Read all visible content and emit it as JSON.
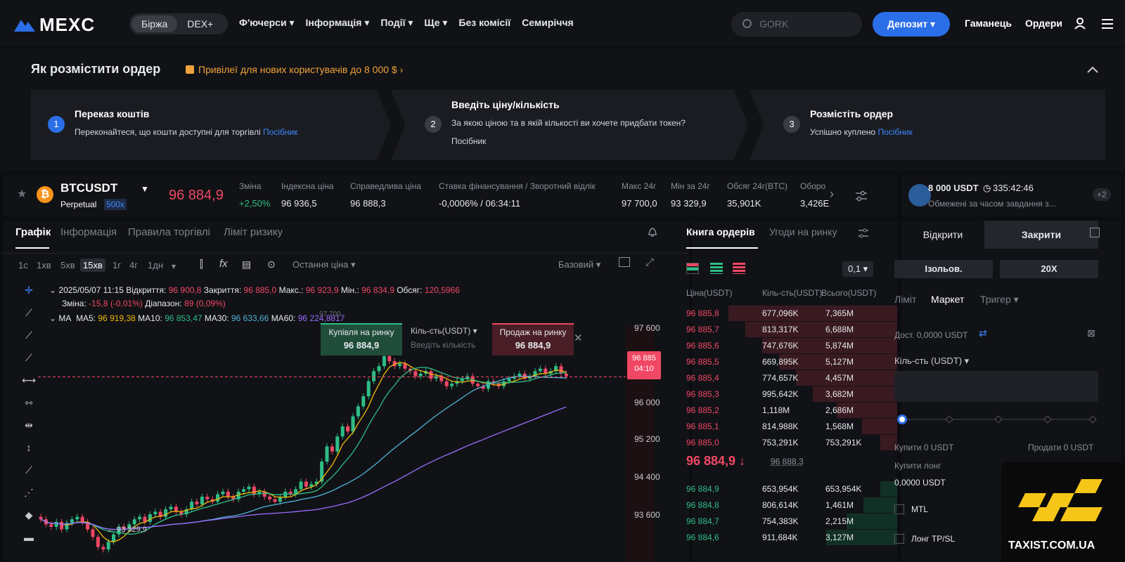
{
  "topbar": {
    "logo": "MEXC",
    "seg": [
      "Біржа",
      "DEX+"
    ],
    "nav": [
      "Ф'ючерси ▾",
      "Інформація ▾",
      "Події ▾",
      "Ще ▾",
      "Без комісії",
      "Семиріччя"
    ],
    "search_placeholder": "GORK",
    "deposit": "Депозит ▾",
    "wallet": "Гаманець",
    "orders": "Ордери"
  },
  "howto": {
    "title": "Як розмістити ордер",
    "promo": "Привілеї для нових користувачів до 8 000 $ ›",
    "steps": [
      {
        "num": "1",
        "title": "Переказ коштів",
        "desc": "Переконайтеся, що кошти доступні для торгівлі",
        "link": "Посібник"
      },
      {
        "num": "2",
        "title": "Введіть ціну/кількість",
        "desc": "За якою ціною та в якій кількості ви хочете придбати токен?",
        "link": "Посібник"
      },
      {
        "num": "3",
        "title": "Розмістіть ордер",
        "desc": "Успішно куплено",
        "link": "Посібник"
      }
    ]
  },
  "ticker": {
    "symbol": "BTCUSDT",
    "type": "Perpetual",
    "lev": "500x",
    "price": "96 884,9",
    "stats": [
      {
        "label": "Зміна",
        "value": "+2,50%"
      },
      {
        "label": "Індексна ціна",
        "value": "96 936,5"
      },
      {
        "label": "Справедлива ціна",
        "value": "96 888,3"
      },
      {
        "label": "Ставка фінансування / Зворотний відлік",
        "value": "-0,0006% / 06:34:11"
      },
      {
        "label": "Макс 24г",
        "value": "97 700,0"
      },
      {
        "label": "Мін за 24г",
        "value": "93 329,9"
      },
      {
        "label": "Обсяг 24г(BTC)",
        "value": "35,901K"
      },
      {
        "label": "Оборо",
        "value": "3,426E"
      }
    ]
  },
  "promo2": {
    "amount": "8 000 USDT",
    "timer": "335:42:46",
    "desc": "Обмежені за часом завдання з...",
    "badge": "+2"
  },
  "chart": {
    "tabs": [
      "Графік",
      "Інформація",
      "Правила торгівлі",
      "Ліміт ризику"
    ],
    "intervals": [
      "1с",
      "1хв",
      "5хв",
      "15хв",
      "1г",
      "4г",
      "1дн"
    ],
    "last_price_label": "Остання ціна ▾",
    "base_label": "Базовий ▾",
    "ohlc": {
      "date": "2025/05/07 11:15",
      "open_l": "Відкриття:",
      "open": "96 900,8",
      "close_l": "Закриття:",
      "close": "96 885,0",
      "high_l": "Макс.:",
      "high": "96 923,9",
      "low_l": "Мін.:",
      "low": "96 834,9",
      "vol_l": "Обсяг:",
      "vol": "120,5966",
      "chg_l": "Зміна:",
      "chg": "-15,8 (-0,01%)",
      "rng_l": "Діапазон:",
      "rng": "89 (0,09%)"
    },
    "ma": {
      "label": "MA",
      "ma5_l": "MA5:",
      "ma5": "96 919,38",
      "ma10_l": "MA10:",
      "ma10": "96 853,47",
      "ma30_l": "MA30:",
      "ma30": "96 633,66",
      "ma60_l": "MA60:",
      "ma60": "96 224,8817"
    },
    "buy_label": "Купівля на ринку",
    "buy_price": "96 884,9",
    "qty_label": "Кіль-сть(USDT) ▾",
    "qty_ph": "Введіть кількість",
    "sell_label": "Продаж на ринку",
    "sell_price": "96 884,9",
    "yaxis": [
      "97 600",
      "96 000",
      "95 200",
      "94 400",
      "93 600"
    ],
    "price_tag": "96 885",
    "time_tag": "04:10",
    "low_label": "← 93 329,9",
    "top_mark": "97 700"
  },
  "orderbook": {
    "tabs": [
      "Книга ордерів",
      "Угоди на ринку"
    ],
    "precision": "0,1 ▾",
    "headers": [
      "Ціна(USDT)",
      "Кіль-сть(USDT)",
      "Всього(USDT)"
    ],
    "asks": [
      [
        "96 885,8",
        "677,096K",
        "7,365M"
      ],
      [
        "96 885,7",
        "813,317K",
        "6,688M"
      ],
      [
        "96 885,6",
        "747,676K",
        "5,874M"
      ],
      [
        "96 885,5",
        "669,895K",
        "5,127M"
      ],
      [
        "96 885,4",
        "774,657K",
        "4,457M"
      ],
      [
        "96 885,3",
        "995,642K",
        "3,682M"
      ],
      [
        "96 885,2",
        "1,118M",
        "2,686M"
      ],
      [
        "96 885,1",
        "814,988K",
        "1,568M"
      ],
      [
        "96 885,0",
        "753,291K",
        "753,291K"
      ]
    ],
    "ask_depth": [
      1.0,
      0.9,
      0.8,
      0.7,
      0.6,
      0.5,
      0.36,
      0.21,
      0.1
    ],
    "mid_price": "96 884,9 ↓",
    "mid_ref": "96 888,3",
    "bids": [
      [
        "96 884,9",
        "653,954K",
        "653,954K"
      ],
      [
        "96 884,8",
        "806,614K",
        "1,461M"
      ],
      [
        "96 884,7",
        "754,383K",
        "2,215M"
      ],
      [
        "96 884,6",
        "911,684K",
        "3,127M"
      ]
    ],
    "bid_depth": [
      0.1,
      0.2,
      0.3,
      0.42
    ]
  },
  "trade": {
    "tabs": [
      "Відкрити",
      "Закрити"
    ],
    "margin": "Ізольов.",
    "leverage": "20X",
    "types": [
      "Ліміт",
      "Маркет",
      "Тригер ▾"
    ],
    "avail": "Дост. 0,0000 USDT",
    "qty": "Кіль-сть (USDT) ▾",
    "buy": "Купити 0 USDT",
    "sell": "Продати 0 USDT",
    "long": "Купити лонг",
    "long_val": "0,0000 USDT",
    "mtl": "MTL",
    "tpsl": "Лонг TP/SL"
  },
  "watermark": "TAXIST.COM.UA"
}
